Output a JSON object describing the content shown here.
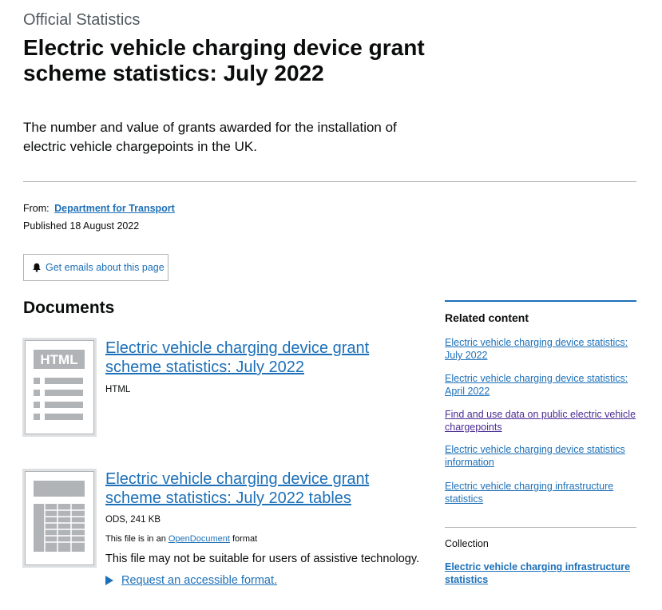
{
  "header": {
    "kicker": "Official Statistics",
    "title": "Electric vehicle charging device grant scheme statistics: July 2022",
    "summary": "The number and value of grants awarded for the installation of electric vehicle chargepoints in the UK."
  },
  "meta": {
    "from_label": "From:",
    "from_link": "Department for Transport",
    "published": "Published 18 August 2022"
  },
  "email_button": {
    "label": "Get emails about this page",
    "icon": "bell-icon"
  },
  "documents": {
    "heading": "Documents",
    "items": [
      {
        "thumb_label": "HTML",
        "title": "Electric vehicle charging device grant scheme statistics: July 2022",
        "format": "HTML"
      },
      {
        "title": "Electric vehicle charging device grant scheme statistics: July 2022 tables",
        "format": "ODS, 241 KB",
        "note_prefix": "This file is in an",
        "note_link": "OpenDocument",
        "note_suffix": "format",
        "warning": "This file may not be suitable for users of assistive technology.",
        "request_link": "Request an accessible format."
      }
    ]
  },
  "sidebar": {
    "heading": "Related content",
    "links": [
      "Electric vehicle charging device statistics: July 2022",
      "Electric vehicle charging device statistics: April 2022",
      "Find and use data on public electric vehicle chargepoints",
      "Electric vehicle charging device statistics information",
      "Electric vehicle charging infrastructure statistics"
    ],
    "collection_label": "Collection",
    "collection_link": "Electric vehicle charging infrastructure statistics"
  },
  "colors": {
    "link": "#1d70b8",
    "visited": "#4c2c92",
    "text": "#0b0c0c",
    "secondary_text": "#505a5f",
    "border": "#b1b4b6",
    "thumb_fill": "#b1b4b6"
  }
}
